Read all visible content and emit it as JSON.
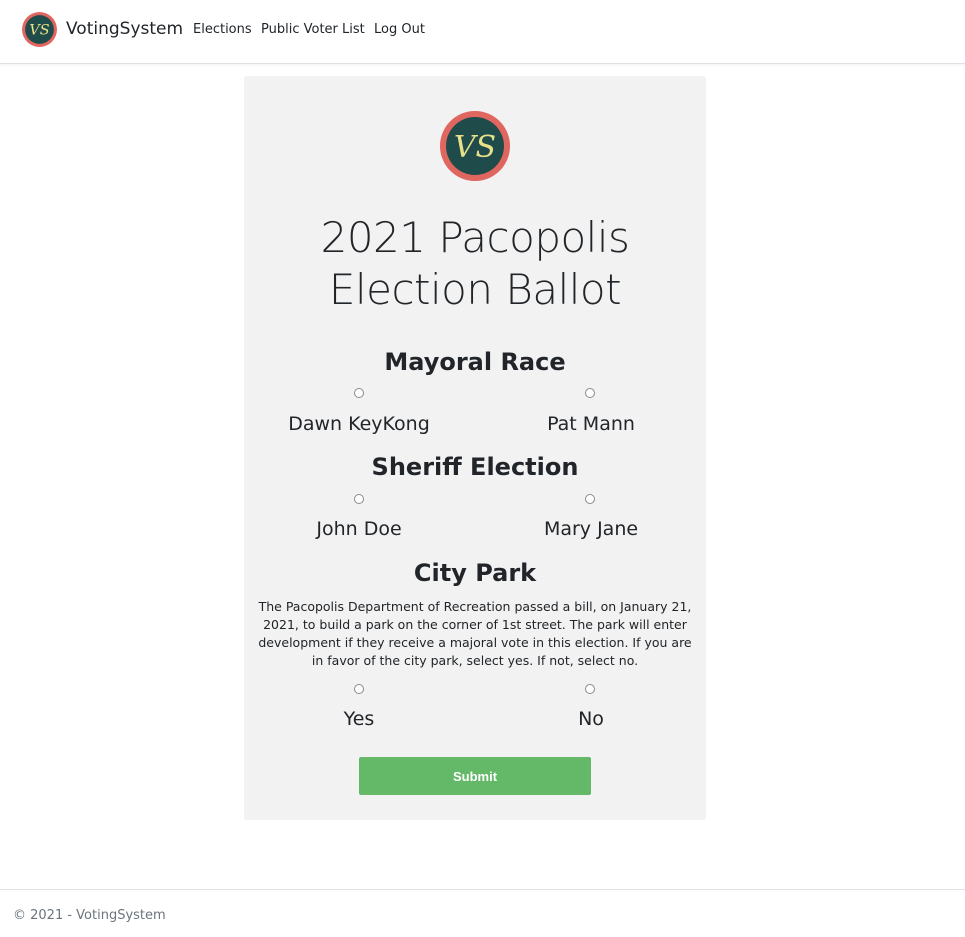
{
  "header": {
    "brand": "VotingSystem",
    "nav": [
      "Elections",
      "Public Voter List",
      "Log Out"
    ]
  },
  "logo": {
    "text": "VS",
    "ring_color": "#e06660",
    "fill_color": "#1f4b4a",
    "letter_color": "#e9e08a"
  },
  "ballot": {
    "title_line1": "2021 Pacopolis",
    "title_line2": "Election Ballot",
    "races": [
      {
        "title": "Mayoral Race",
        "options": [
          "Dawn KeyKong",
          "Pat Mann"
        ]
      },
      {
        "title": "Sheriff Election",
        "options": [
          "John Doe",
          "Mary Jane"
        ]
      },
      {
        "title": "City Park",
        "description": "The Pacopolis Department of Recreation passed a bill, on January 21, 2021, to build a park on the corner of 1st street. The park will enter development if they receive a majoral vote in this election. If you are in favor of the city park, select yes. If not, select no.",
        "options": [
          "Yes",
          "No"
        ]
      }
    ],
    "submit_label": "Submit",
    "submit_color": "#63b968"
  },
  "footer": {
    "text": "© 2021 - VotingSystem"
  }
}
